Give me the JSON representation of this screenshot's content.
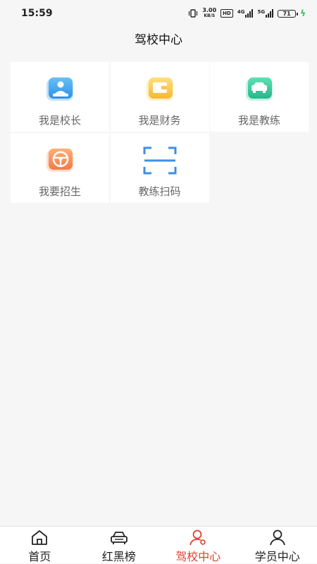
{
  "status_bar": {
    "time": "15:59",
    "net_speed_value": "3.00",
    "net_speed_unit": "KB/S",
    "hd_badge": "HD",
    "signal1_label": "4G",
    "signal2_label": "5G",
    "battery": "71"
  },
  "header": {
    "title": "驾校中心"
  },
  "menu": [
    {
      "label": "我是校长",
      "icon": "principal-icon"
    },
    {
      "label": "我是财务",
      "icon": "wallet-icon"
    },
    {
      "label": "我是教练",
      "icon": "car-icon"
    },
    {
      "label": "我要招生",
      "icon": "steering-wheel-icon"
    },
    {
      "label": "教练扫码",
      "icon": "scan-icon"
    }
  ],
  "tabbar": {
    "items": [
      {
        "label": "首页",
        "icon": "home-icon"
      },
      {
        "label": "红黑榜",
        "icon": "car-outline-icon"
      },
      {
        "label": "驾校中心",
        "icon": "user-location-icon",
        "active": true
      },
      {
        "label": "学员中心",
        "icon": "user-icon"
      }
    ],
    "active_color": "#e0402f"
  }
}
